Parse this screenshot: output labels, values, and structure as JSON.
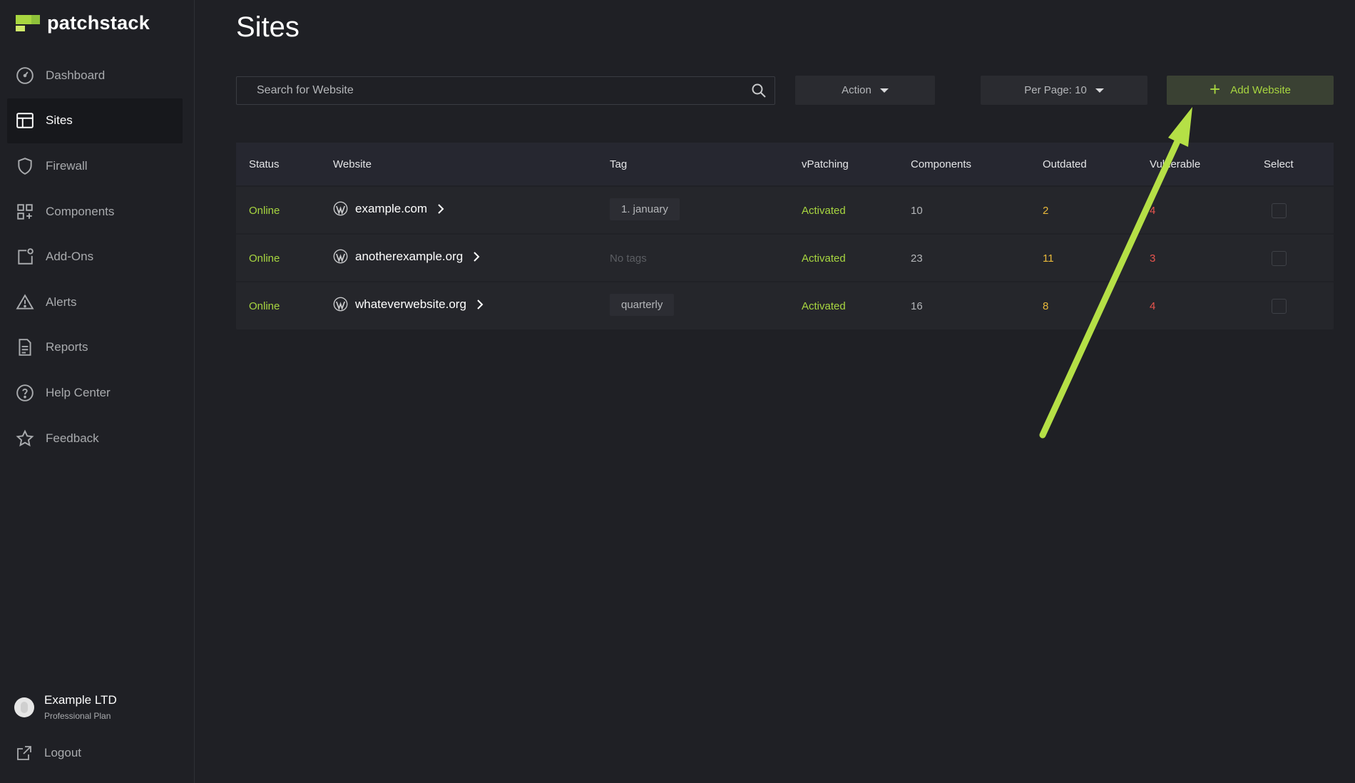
{
  "app": {
    "brand": "patchstack",
    "page_title": "Sites"
  },
  "sidebar": {
    "items": [
      {
        "label": "Dashboard",
        "icon": "gauge-icon",
        "active": false
      },
      {
        "label": "Sites",
        "icon": "layout-icon",
        "active": true
      },
      {
        "label": "Firewall",
        "icon": "shield-icon",
        "active": false
      },
      {
        "label": "Components",
        "icon": "grid-plus-icon",
        "active": false
      },
      {
        "label": "Add-Ons",
        "icon": "add-on-icon",
        "active": false
      },
      {
        "label": "Alerts",
        "icon": "alert-triangle-icon",
        "active": false
      },
      {
        "label": "Reports",
        "icon": "document-icon",
        "active": false
      },
      {
        "label": "Help Center",
        "icon": "help-circle-icon",
        "active": false
      },
      {
        "label": "Feedback",
        "icon": "star-icon",
        "active": false
      }
    ],
    "account": {
      "name": "Example LTD",
      "plan": "Professional Plan"
    },
    "logout_label": "Logout"
  },
  "toolbar": {
    "search_placeholder": "Search for Website",
    "action_label": "Action",
    "per_page_label": "Per Page: 10",
    "add_label": "Add Website"
  },
  "table": {
    "headers": {
      "status": "Status",
      "website": "Website",
      "tag": "Tag",
      "vpatching": "vPatching",
      "components": "Components",
      "outdated": "Outdated",
      "vulnerable": "Vulnerable",
      "select": "Select"
    },
    "rows": [
      {
        "status": "Online",
        "website": "example.com",
        "tag": "1. january",
        "vpatching": "Activated",
        "components": "10",
        "outdated": "2",
        "vulnerable": "4"
      },
      {
        "status": "Online",
        "website": "anotherexample.org",
        "tag": "No tags",
        "vpatching": "Activated",
        "components": "23",
        "outdated": "11",
        "vulnerable": "3"
      },
      {
        "status": "Online",
        "website": "whateverwebsite.org",
        "tag": "quarterly",
        "vpatching": "Activated",
        "components": "16",
        "outdated": "8",
        "vulnerable": "4"
      }
    ]
  },
  "colors": {
    "accent": "#a8d640",
    "outdated": "#e9b93b",
    "vulnerable": "#e8544e",
    "annotation_arrow": "#b5e046"
  }
}
